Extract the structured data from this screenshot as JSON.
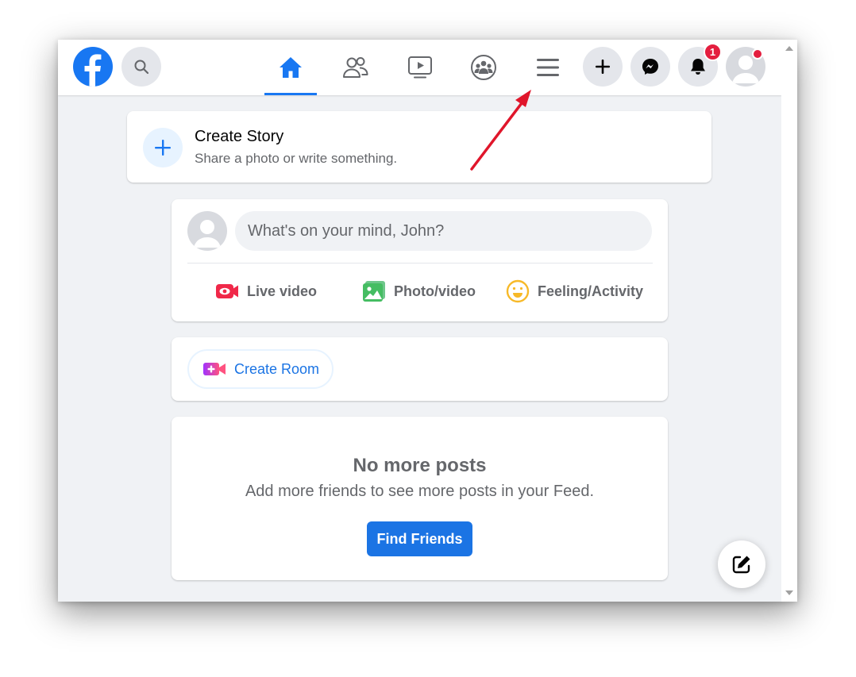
{
  "header": {
    "notification_count": "1",
    "nav_tabs": [
      "home",
      "friends",
      "watch",
      "groups",
      "menu"
    ],
    "active_tab": "home"
  },
  "story": {
    "title": "Create Story",
    "subtitle": "Share a photo or write something."
  },
  "composer": {
    "placeholder": "What's on your mind, John?",
    "actions": {
      "live": "Live video",
      "photo": "Photo/video",
      "feeling": "Feeling/Activity"
    }
  },
  "room": {
    "label": "Create Room"
  },
  "empty_feed": {
    "title": "No more posts",
    "subtitle": "Add more friends to see more posts in your Feed.",
    "button": "Find Friends"
  },
  "colors": {
    "brand": "#1877f2",
    "badge": "#e41e3f",
    "annotation_arrow": "#e0162b",
    "background": "#f0f2f5"
  },
  "icons": {
    "search": "search-icon",
    "home": "home-icon",
    "friends": "friends-icon",
    "watch": "video-play-icon",
    "groups": "groups-icon",
    "menu": "hamburger-menu-icon",
    "create": "plus-icon",
    "messenger": "messenger-icon",
    "notifications": "bell-icon",
    "compose": "edit-icon"
  }
}
